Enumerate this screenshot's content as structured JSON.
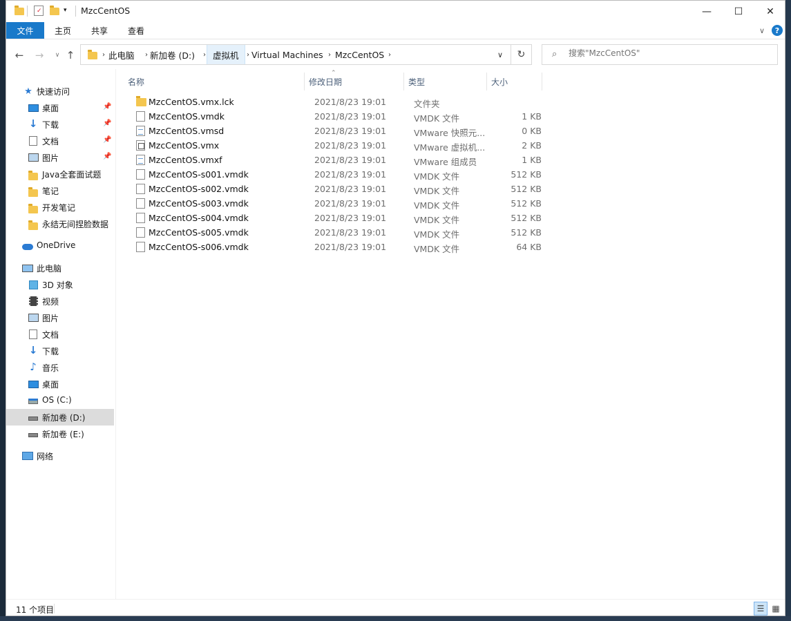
{
  "window": {
    "title": "MzcCentOS",
    "controls": {
      "minimize": "—",
      "maximize": "☐",
      "close": "✕"
    }
  },
  "ribbon": {
    "tabs": [
      "文件",
      "主页",
      "共享",
      "查看"
    ],
    "expand_icon": "∨",
    "help_icon": "?"
  },
  "address": {
    "crumbs": [
      "此电脑",
      "新加卷 (D:)",
      "虚拟机",
      "Virtual Machines",
      "MzcCentOS"
    ]
  },
  "search": {
    "placeholder": "搜索\"MzcCentOS\""
  },
  "navpane": {
    "quick_access": "快速访问",
    "quick_items": [
      "桌面",
      "下载",
      "文档",
      "图片",
      "Java全套面试题",
      "笔记",
      "开发笔记",
      "永结无间捏脸数据"
    ],
    "onedrive": "OneDrive",
    "this_pc": "此电脑",
    "pc_items": [
      "3D 对象",
      "视频",
      "图片",
      "文档",
      "下载",
      "音乐",
      "桌面",
      "OS (C:)",
      "新加卷 (D:)",
      "新加卷 (E:)"
    ],
    "network": "网络"
  },
  "columns": {
    "name": "名称",
    "date": "修改日期",
    "type": "类型",
    "size": "大小"
  },
  "files": [
    {
      "name": "MzcCentOS.vmx.lck",
      "date": "2021/8/23 19:01",
      "type": "文件夹",
      "size": ""
    },
    {
      "name": "MzcCentOS.vmdk",
      "date": "2021/8/23 19:01",
      "type": "VMDK 文件",
      "size": "1 KB"
    },
    {
      "name": "MzcCentOS.vmsd",
      "date": "2021/8/23 19:01",
      "type": "VMware 快照元...",
      "size": "0 KB"
    },
    {
      "name": "MzcCentOS.vmx",
      "date": "2021/8/23 19:01",
      "type": "VMware 虚拟机...",
      "size": "2 KB"
    },
    {
      "name": "MzcCentOS.vmxf",
      "date": "2021/8/23 19:01",
      "type": "VMware 组成员",
      "size": "1 KB"
    },
    {
      "name": "MzcCentOS-s001.vmdk",
      "date": "2021/8/23 19:01",
      "type": "VMDK 文件",
      "size": "512 KB"
    },
    {
      "name": "MzcCentOS-s002.vmdk",
      "date": "2021/8/23 19:01",
      "type": "VMDK 文件",
      "size": "512 KB"
    },
    {
      "name": "MzcCentOS-s003.vmdk",
      "date": "2021/8/23 19:01",
      "type": "VMDK 文件",
      "size": "512 KB"
    },
    {
      "name": "MzcCentOS-s004.vmdk",
      "date": "2021/8/23 19:01",
      "type": "VMDK 文件",
      "size": "512 KB"
    },
    {
      "name": "MzcCentOS-s005.vmdk",
      "date": "2021/8/23 19:01",
      "type": "VMDK 文件",
      "size": "512 KB"
    },
    {
      "name": "MzcCentOS-s006.vmdk",
      "date": "2021/8/23 19:01",
      "type": "VMDK 文件",
      "size": "64 KB"
    }
  ],
  "status": {
    "count": "11 个项目"
  },
  "colors": {
    "accent": "#1979ca",
    "folder": "#f4c64f",
    "selected": "#dcdcdc"
  }
}
